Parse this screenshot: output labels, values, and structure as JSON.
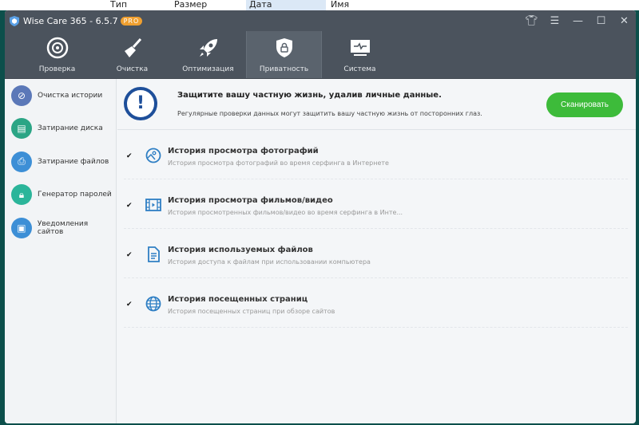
{
  "background_window": {
    "columns": [
      "Тип",
      "Размер",
      "Дата",
      "Имя"
    ]
  },
  "app": {
    "title": "Wise Care 365 - 6.5.7",
    "badge": "PRO"
  },
  "window_controls": [
    "skin",
    "menu",
    "minimize",
    "maximize",
    "close"
  ],
  "tabs": [
    {
      "label": "Проверка",
      "icon": "radar-icon"
    },
    {
      "label": "Очистка",
      "icon": "broom-icon"
    },
    {
      "label": "Оптимизация",
      "icon": "rocket-icon"
    },
    {
      "label": "Приватность",
      "icon": "shield-lock-icon",
      "active": true
    },
    {
      "label": "Система",
      "icon": "monitor-icon"
    }
  ],
  "sidebar": {
    "items": [
      {
        "label": "Очистка истории",
        "color": "#5b78b8"
      },
      {
        "label": "Затирание диска",
        "color": "#2ba585"
      },
      {
        "label": "Затирание файлов",
        "color": "#3d8fd6"
      },
      {
        "label": "Генератор паролей",
        "color": "#2bb59a"
      },
      {
        "label": "Уведомления сайтов",
        "color": "#3d8fd6"
      }
    ]
  },
  "banner": {
    "heading": "Защитите вашу частную жизнь, удалив личные данные.",
    "subtext": "Регулярные проверки данных могут защитить вашу частную жизнь от посторонних глаз.",
    "scan_label": "Сканировать"
  },
  "items": [
    {
      "title": "История просмотра фотографий",
      "desc": "История просмотра фотографий во время серфинга в Интернете",
      "checked": true
    },
    {
      "title": "История просмотра фильмов/видео",
      "desc": "История просмотренных фильмов/видео во время серфинга в Инте...",
      "checked": true
    },
    {
      "title": "История используемых файлов",
      "desc": "История доступа к файлам при использовании компьютера",
      "checked": true
    },
    {
      "title": "История посещенных страниц",
      "desc": "История посещенных страниц при обзоре сайтов",
      "checked": true
    }
  ]
}
